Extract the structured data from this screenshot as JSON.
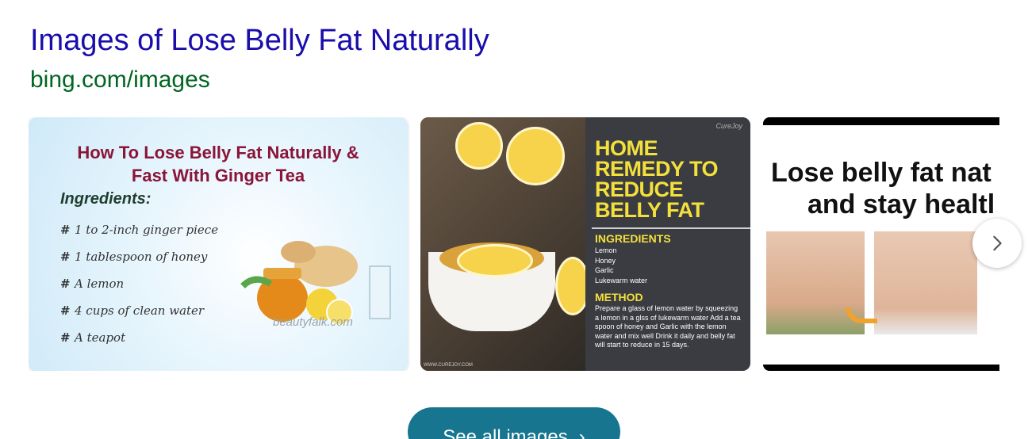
{
  "result": {
    "title": "Images of Lose Belly Fat Naturally",
    "url": "bing.com/images"
  },
  "images": [
    {
      "heading_line1": "How To Lose Belly Fat Naturally &",
      "heading_line2": "Fast With Ginger Tea",
      "ingredients_label": "Ingredients:",
      "items": [
        "1 to 2-inch ginger piece",
        "1 tablespoon of honey",
        "A lemon",
        "4 cups of clean water",
        "A teapot"
      ],
      "watermark": "beautyfalk.com"
    },
    {
      "headline_l1": "HOME",
      "headline_l2": "REMEDY TO",
      "headline_l3": "REDUCE",
      "headline_l4": "BELLY FAT",
      "ingredients_title": "INGREDIENTS",
      "ing1": "Lemon",
      "ing2": "Honey",
      "ing3": "Garlic",
      "ing4": "Lukewarm water",
      "method_title": "METHOD",
      "method_text": "Prepare a glass of lemon water by squeezing a lemon in a glss of lukewarm water Add a tea spoon of honey and Garlic with the lemon water and mix well Drink it daily and belly fat will start to reduce in 15 days.",
      "logo": "CureJoy",
      "credit": "WWW.CUREJOY.COM"
    },
    {
      "line1": "Lose belly fat nat",
      "line2": "and stay healtl"
    }
  ],
  "controls": {
    "next_icon": "chevron-right-icon",
    "see_all_label": "See all images",
    "see_all_icon": "›"
  },
  "colors": {
    "title": "#1a0dab",
    "url": "#006621",
    "button": "#17758f"
  }
}
